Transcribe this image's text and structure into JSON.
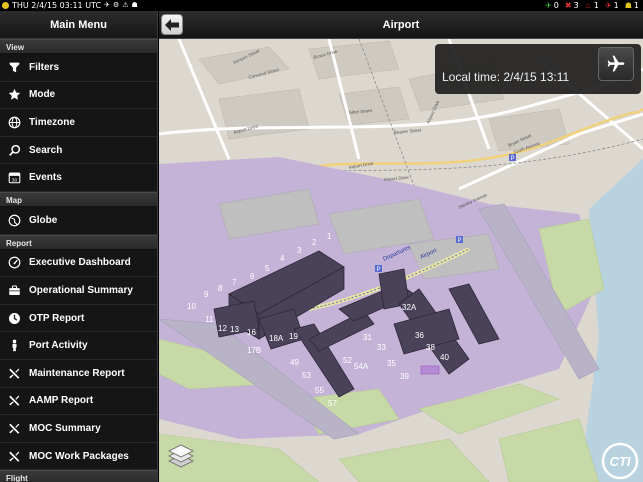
{
  "status_bar": {
    "datetime": "THU 2/4/15 03:11 UTC",
    "indicators": [
      {
        "icon": "plane-icon",
        "value": "0",
        "color": "#3fbf3f"
      },
      {
        "icon": "wrench-icon",
        "value": "3",
        "color": "#e03030"
      },
      {
        "icon": "fire-icon",
        "value": "1",
        "color": "#e03030"
      },
      {
        "icon": "plane-alert-icon",
        "value": "1",
        "color": "#e03030"
      },
      {
        "icon": "person-icon",
        "value": "1",
        "color": "#e2c51c"
      }
    ]
  },
  "sidebar": {
    "title": "Main Menu",
    "sections": [
      {
        "title": "View",
        "items": [
          {
            "label": "Filters",
            "icon": "filter-icon"
          },
          {
            "label": "Mode",
            "icon": "star-icon"
          },
          {
            "label": "Timezone",
            "icon": "globe-icon"
          },
          {
            "label": "Search",
            "icon": "search-icon"
          },
          {
            "label": "Events",
            "icon": "calendar-icon"
          }
        ]
      },
      {
        "title": "Map",
        "items": [
          {
            "label": "Globe",
            "icon": "globe-icon"
          }
        ]
      },
      {
        "title": "Report",
        "items": [
          {
            "label": "Executive Dashboard",
            "icon": "gauge-icon"
          },
          {
            "label": "Operational Summary",
            "icon": "briefcase-icon"
          },
          {
            "label": "OTP Report",
            "icon": "clock-icon"
          },
          {
            "label": "Port Activity",
            "icon": "person-icon"
          },
          {
            "label": "Maintenance Report",
            "icon": "tools-icon"
          },
          {
            "label": "AAMP Report",
            "icon": "tools-icon"
          },
          {
            "label": "MOC Summary",
            "icon": "tools-icon"
          },
          {
            "label": "MOC Work Packages",
            "icon": "tools-icon"
          }
        ]
      },
      {
        "title": "Flight",
        "items": []
      }
    ]
  },
  "nav": {
    "title": "Airport",
    "back_icon": "back-arrow-icon"
  },
  "local_time": {
    "label": "Local time: 2/4/15 13:11",
    "button_icon": "plane-icon"
  },
  "map": {
    "gates": [
      "1",
      "2",
      "3",
      "4",
      "5",
      "6",
      "7",
      "8",
      "9",
      "10",
      "11",
      "12",
      "13",
      "16",
      "17B",
      "18A",
      "19",
      "49",
      "52",
      "53",
      "54A",
      "55",
      "57",
      "31",
      "33",
      "35",
      "36",
      "38",
      "39",
      "40",
      "32A"
    ],
    "streets": [
      "Airport Drive",
      "Airport Drive",
      "Airport Drive",
      "Bryan Street",
      "Brown Drive",
      "Kenyon Street",
      "Corwood Street",
      "Beaver Street",
      "Sibel Street",
      "Stanley Avenue",
      "South Avenue",
      "Airport Drive"
    ],
    "terminal_labels": [
      "Departures",
      "Airport"
    ],
    "colors": {
      "water": "#b8d3df",
      "airport": "#c4b3d6",
      "grass": "#c8d9a8",
      "land": "#dcd7cf",
      "terminal": "#4a4258"
    }
  },
  "footer": {
    "logo_text": "CTI"
  }
}
